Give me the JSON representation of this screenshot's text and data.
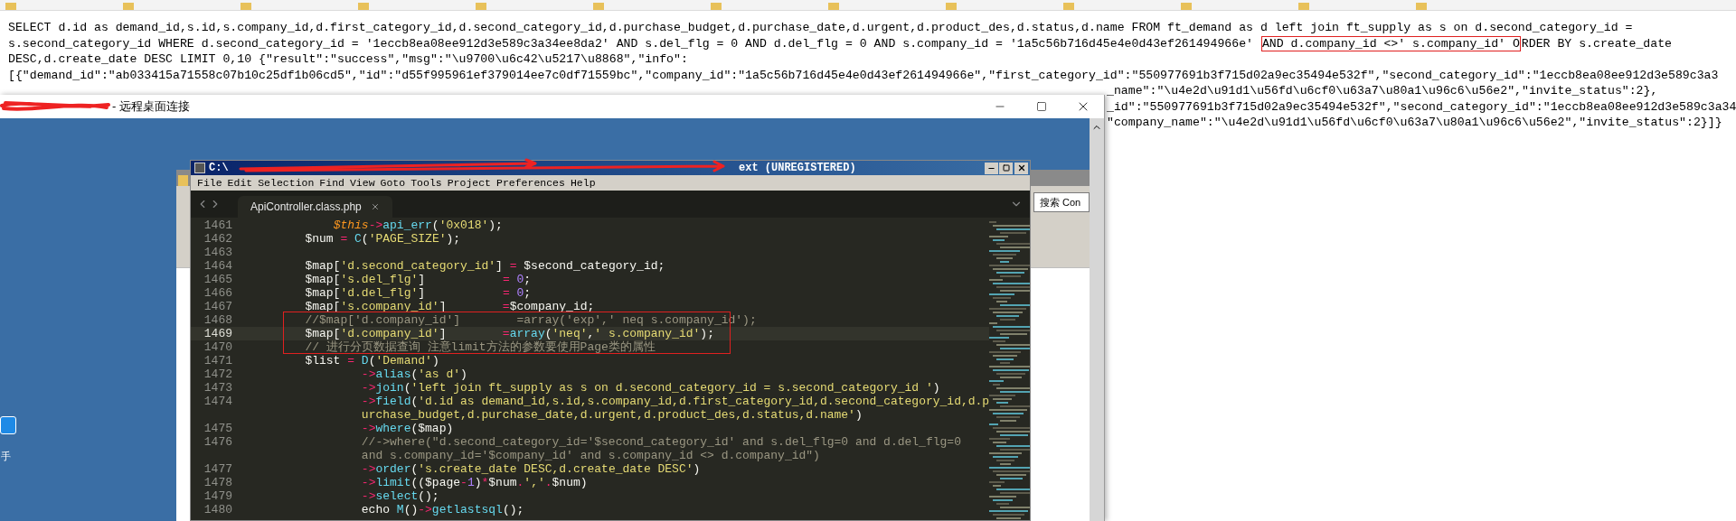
{
  "sql_output": {
    "lines": [
      {
        "segments": [
          {
            "text": "SELECT d.id as demand_id,s.id,s.company_id,d.first_category_id,d.second_category_id,d.purchase_budget,d.purchase_date,d.urgent,d.product_des,d.status,d.name FROM ft_demand as d left join ft_supply as s on d.second_category_id =",
            "annotated": false
          }
        ]
      },
      {
        "segments": [
          {
            "text": "s.second_category_id WHERE d.second_category_id = '1eccb8ea08ee912d3e589c3a34ee8da2' AND s.del_flg = 0 AND d.del_flg = 0 AND s.company_id = '1a5c56b716d45e4e0d43ef261494966e' ",
            "annotated": false
          },
          {
            "text": "AND d.company_id <>' s.company_id' O",
            "annotated": true
          },
          {
            "text": "RDER BY s.create_date",
            "annotated": false
          }
        ]
      },
      {
        "segments": [
          {
            "text": "DESC,d.create_date DESC LIMIT 0,10 {\"result\":\"success\",\"msg\":\"\\u9700\\u6c42\\u5217\\u8868\",\"info\":",
            "annotated": false
          }
        ]
      },
      {
        "segments": [
          {
            "text": "[{\"demand_id\":\"ab033415a71558c07b10c25df1b06cd5\",\"id\":\"d55f995961ef379014ee7c0df71559bc\",\"company_id\":\"1a5c56b716d45e4e0d43ef261494966e\",\"first_category_id\":\"550977691b3f715d02a9ec35494e532f\",\"second_category_id\":\"1eccb8ea08ee912d3e589c3a3",
            "annotated": false
          }
        ]
      }
    ],
    "partly_hidden_lines": [
      "_name\":\"\\u4e2d\\u91d1\\u56fd\\u6cf0\\u63a7\\u80a1\\u96c6\\u56e2\",\"invite_status\":2},",
      "_id\":\"550977691b3f715d02a9ec35494e532f\",\"second_category_id\":\"1eccb8ea08ee912d3e589c3a34",
      "\"company_name\":\"\\u4e2d\\u91d1\\u56fd\\u6cf0\\u63a7\\u80a1\\u96c6\\u56e2\",\"invite_status\":2}]}"
    ]
  },
  "remote_window": {
    "title": "- 远程桌面连接"
  },
  "desktop": {
    "icon_label": "手"
  },
  "background_window": {
    "search_field": {
      "value": "搜索 Con"
    }
  },
  "editor": {
    "title_start": "C:\\",
    "title_end": "ext (UNREGISTERED)",
    "menu": [
      "File",
      "Edit",
      "Selection",
      "Find",
      "View",
      "Goto",
      "Tools",
      "Project",
      "Preferences",
      "Help"
    ],
    "tabs": [
      {
        "label": "ApiController.class.php",
        "selected": true
      }
    ],
    "lines": [
      {
        "number": "1461",
        "current": false,
        "rows": [
          [
            {
              "kind": "plain",
              "text": "            "
            },
            {
              "kind": "var",
              "text": "$this"
            },
            {
              "kind": "op",
              "text": "->"
            },
            {
              "kind": "fn",
              "text": "api_err"
            },
            {
              "kind": "plain",
              "text": "("
            },
            {
              "kind": "str",
              "text": "'0x018'"
            },
            {
              "kind": "plain",
              "text": ");"
            }
          ]
        ]
      },
      {
        "number": "1462",
        "current": false,
        "rows": [
          [
            {
              "kind": "plain",
              "text": "        $num "
            },
            {
              "kind": "op",
              "text": "="
            },
            {
              "kind": "plain",
              "text": " "
            },
            {
              "kind": "fn",
              "text": "C"
            },
            {
              "kind": "plain",
              "text": "("
            },
            {
              "kind": "str",
              "text": "'PAGE_SIZE'"
            },
            {
              "kind": "plain",
              "text": ");"
            }
          ]
        ]
      },
      {
        "number": "1463",
        "current": false
      },
      {
        "number": "1464",
        "current": false,
        "rows": [
          [
            {
              "kind": "plain",
              "text": "        $map["
            },
            {
              "kind": "str",
              "text": "'d.second_category_id'"
            },
            {
              "kind": "plain",
              "text": "] "
            },
            {
              "kind": "op",
              "text": "="
            },
            {
              "kind": "plain",
              "text": " $second_category_id;"
            }
          ]
        ]
      },
      {
        "number": "1465",
        "current": false,
        "rows": [
          [
            {
              "kind": "plain",
              "text": "        $map["
            },
            {
              "kind": "str",
              "text": "'s.del_flg'"
            },
            {
              "kind": "plain",
              "text": "]           "
            },
            {
              "kind": "op",
              "text": "="
            },
            {
              "kind": "plain",
              "text": " "
            },
            {
              "kind": "num",
              "text": "0"
            },
            {
              "kind": "plain",
              "text": ";"
            }
          ]
        ]
      },
      {
        "number": "1466",
        "current": false,
        "rows": [
          [
            {
              "kind": "plain",
              "text": "        $map["
            },
            {
              "kind": "str",
              "text": "'d.del_flg'"
            },
            {
              "kind": "plain",
              "text": "]           "
            },
            {
              "kind": "op",
              "text": "="
            },
            {
              "kind": "plain",
              "text": " "
            },
            {
              "kind": "num",
              "text": "0"
            },
            {
              "kind": "plain",
              "text": ";"
            }
          ]
        ]
      },
      {
        "number": "1467",
        "current": false,
        "rows": [
          [
            {
              "kind": "plain",
              "text": "        $map["
            },
            {
              "kind": "str",
              "text": "'s.company_id'"
            },
            {
              "kind": "plain",
              "text": "]        "
            },
            {
              "kind": "op",
              "text": "="
            },
            {
              "kind": "plain",
              "text": "$company_id;"
            }
          ]
        ]
      },
      {
        "number": "1468",
        "current": false,
        "rows": [
          [
            {
              "kind": "comment",
              "text": "        //$map['d.company_id']        =array('exp',' neq s.company_id');"
            }
          ]
        ]
      },
      {
        "number": "1469",
        "current": true,
        "rows": [
          [
            {
              "kind": "plain",
              "text": "        $map["
            },
            {
              "kind": "str",
              "text": "'d.company_id'"
            },
            {
              "kind": "plain",
              "text": "]        "
            },
            {
              "kind": "op",
              "text": "="
            },
            {
              "kind": "fn",
              "text": "array"
            },
            {
              "kind": "plain",
              "text": "("
            },
            {
              "kind": "str",
              "text": "'neq'"
            },
            {
              "kind": "plain",
              "text": ","
            },
            {
              "kind": "str",
              "text": "' s.company_id'"
            },
            {
              "kind": "plain",
              "text": ");"
            }
          ]
        ]
      },
      {
        "number": "1470",
        "current": false,
        "rows": [
          [
            {
              "kind": "comment",
              "text": "        // 进行分页数据查询 注意limit方法的参数要使用Page类的属性"
            }
          ]
        ]
      },
      {
        "number": "1471",
        "current": false,
        "rows": [
          [
            {
              "kind": "plain",
              "text": "        $list "
            },
            {
              "kind": "op",
              "text": "="
            },
            {
              "kind": "plain",
              "text": " "
            },
            {
              "kind": "fn",
              "text": "D"
            },
            {
              "kind": "plain",
              "text": "("
            },
            {
              "kind": "str",
              "text": "'Demand'"
            },
            {
              "kind": "plain",
              "text": ")"
            }
          ]
        ]
      },
      {
        "number": "1472",
        "current": false,
        "rows": [
          [
            {
              "kind": "plain",
              "text": "                "
            },
            {
              "kind": "op",
              "text": "->"
            },
            {
              "kind": "fn",
              "text": "alias"
            },
            {
              "kind": "plain",
              "text": "("
            },
            {
              "kind": "str",
              "text": "'as d'"
            },
            {
              "kind": "plain",
              "text": ")"
            }
          ]
        ]
      },
      {
        "number": "1473",
        "current": false,
        "rows": [
          [
            {
              "kind": "plain",
              "text": "                "
            },
            {
              "kind": "op",
              "text": "->"
            },
            {
              "kind": "fn",
              "text": "join"
            },
            {
              "kind": "plain",
              "text": "("
            },
            {
              "kind": "str",
              "text": "'left join ft_supply as s on d.second_category_id = s.second_category_id '"
            },
            {
              "kind": "plain",
              "text": ")"
            }
          ]
        ]
      },
      {
        "number": "1474",
        "current": false,
        "rows": [
          [
            {
              "kind": "plain",
              "text": "                "
            },
            {
              "kind": "op",
              "text": "->"
            },
            {
              "kind": "fn",
              "text": "field"
            },
            {
              "kind": "plain",
              "text": "("
            },
            {
              "kind": "str",
              "text": "'d.id as demand_id,s.id,s.company_id,d.first_category_id,d.second_category_id,d.p"
            }
          ]
        ],
        "continuation": [
          {
            "kind": "str",
            "text": "urchase_budget,d.purchase_date,d.urgent,d.product_des,d.status,d.name'"
          },
          {
            "kind": "plain",
            "text": ")"
          }
        ]
      },
      {
        "number": "1475",
        "current": false,
        "rows": [
          [
            {
              "kind": "plain",
              "text": "                "
            },
            {
              "kind": "op",
              "text": "->"
            },
            {
              "kind": "fn",
              "text": "where"
            },
            {
              "kind": "plain",
              "text": "($map)"
            }
          ]
        ]
      },
      {
        "number": "1476",
        "current": false,
        "rows": [
          [
            {
              "kind": "comment",
              "text": "                //->where(\"d.second_category_id='$second_category_id' and s.del_flg=0 and d.del_flg=0"
            }
          ]
        ],
        "continuation": [
          {
            "kind": "comment",
            "text": "and s.company_id='$company_id' and s.company_id <> d.company_id\")"
          }
        ]
      },
      {
        "number": "1477",
        "current": false,
        "rows": [
          [
            {
              "kind": "plain",
              "text": "                "
            },
            {
              "kind": "op",
              "text": "->"
            },
            {
              "kind": "fn",
              "text": "order"
            },
            {
              "kind": "plain",
              "text": "("
            },
            {
              "kind": "str",
              "text": "'s.create_date DESC,d.create_date DESC'"
            },
            {
              "kind": "plain",
              "text": ")"
            }
          ]
        ]
      },
      {
        "number": "1478",
        "current": false,
        "rows": [
          [
            {
              "kind": "plain",
              "text": "                "
            },
            {
              "kind": "op",
              "text": "->"
            },
            {
              "kind": "fn",
              "text": "limit"
            },
            {
              "kind": "plain",
              "text": "(($page"
            },
            {
              "kind": "op",
              "text": "-"
            },
            {
              "kind": "num",
              "text": "1"
            },
            {
              "kind": "plain",
              "text": ")"
            },
            {
              "kind": "op",
              "text": "*"
            },
            {
              "kind": "plain",
              "text": "$num"
            },
            {
              "kind": "op",
              "text": "."
            },
            {
              "kind": "str",
              "text": "','"
            },
            {
              "kind": "op",
              "text": "."
            },
            {
              "kind": "plain",
              "text": "$num)"
            }
          ]
        ]
      },
      {
        "number": "1479",
        "current": false,
        "rows": [
          [
            {
              "kind": "plain",
              "text": "                "
            },
            {
              "kind": "op",
              "text": "->"
            },
            {
              "kind": "fn",
              "text": "select"
            },
            {
              "kind": "plain",
              "text": "();"
            }
          ]
        ]
      },
      {
        "number": "1480",
        "current": false,
        "rows": [
          [
            {
              "kind": "plain",
              "text": "                echo "
            },
            {
              "kind": "fn",
              "text": "M"
            },
            {
              "kind": "plain",
              "text": "()"
            },
            {
              "kind": "op",
              "text": "->"
            },
            {
              "kind": "fn",
              "text": "getlastsql"
            },
            {
              "kind": "plain",
              "text": "();"
            }
          ]
        ]
      }
    ]
  }
}
